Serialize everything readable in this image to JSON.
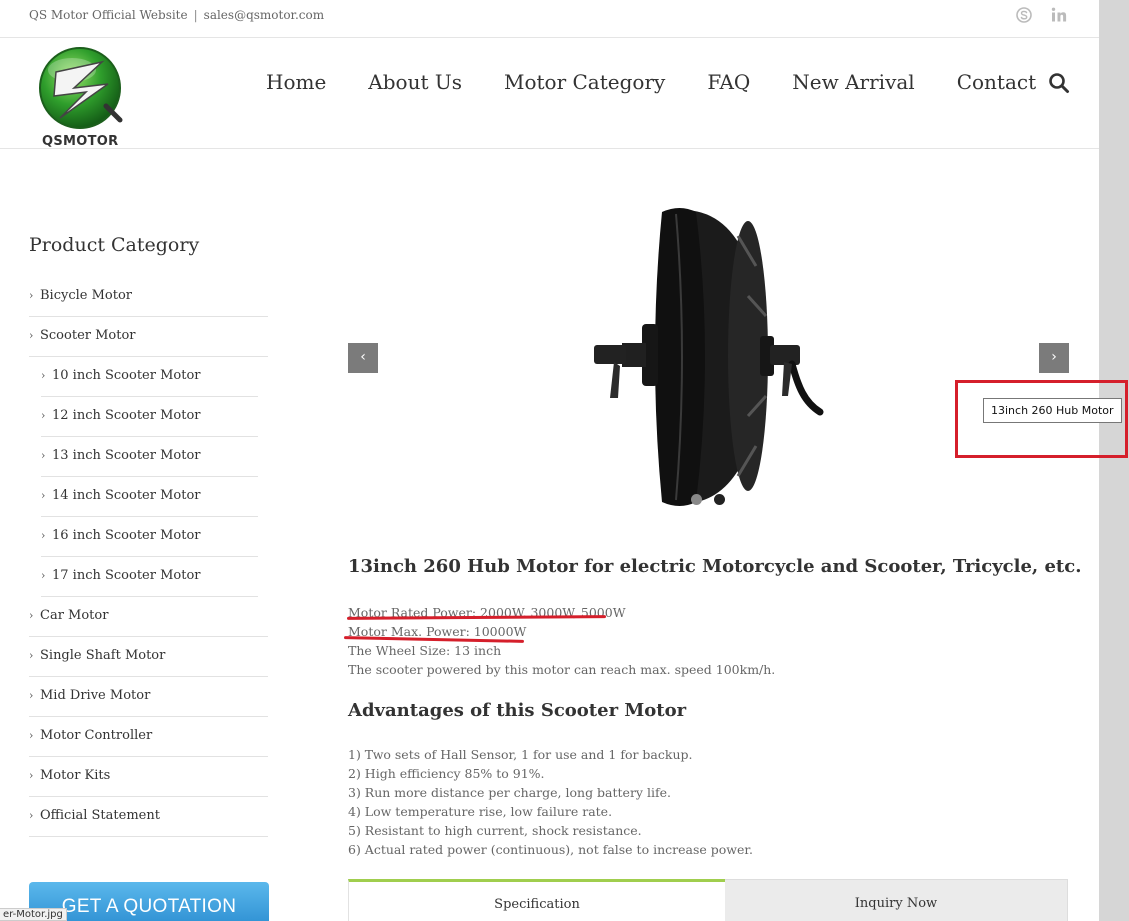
{
  "topbar": {
    "site_name": "QS Motor Official Website",
    "separator": "|",
    "email": "sales@qsmotor.com"
  },
  "header": {
    "logo_text": "QSMOTOR",
    "nav": [
      "Home",
      "About Us",
      "Motor Category",
      "FAQ",
      "New Arrival",
      "Contact"
    ]
  },
  "sidebar": {
    "title": "Product Category",
    "items": [
      {
        "label": "Bicycle Motor",
        "sub": false
      },
      {
        "label": "Scooter Motor",
        "sub": false
      },
      {
        "label": "10 inch Scooter Motor",
        "sub": true
      },
      {
        "label": "12 inch Scooter Motor",
        "sub": true
      },
      {
        "label": "13 inch Scooter Motor",
        "sub": true
      },
      {
        "label": "14 inch Scooter Motor",
        "sub": true
      },
      {
        "label": "16 inch Scooter Motor",
        "sub": true
      },
      {
        "label": "17 inch Scooter Motor",
        "sub": true
      },
      {
        "label": "Car Motor",
        "sub": false
      },
      {
        "label": "Single Shaft Motor",
        "sub": false
      },
      {
        "label": "Mid Drive Motor",
        "sub": false
      },
      {
        "label": "Motor Controller",
        "sub": false
      },
      {
        "label": "Motor Kits",
        "sub": false
      },
      {
        "label": "Official Statement",
        "sub": false
      }
    ],
    "quote_button": "GET A QUOTATION"
  },
  "slider": {
    "prev": "‹",
    "next": "›",
    "tooltip": "13inch 260 Hub Motor",
    "slides": 2,
    "active_slide": 2
  },
  "product": {
    "title": "13inch 260 Hub Motor for electric Motorcycle and Scooter, Tricycle, etc.",
    "specs": [
      "Motor Rated Power: 2000W, 3000W, 5000W",
      "Motor Max. Power: 10000W",
      "The Wheel Size: 13 inch",
      "The scooter powered by this motor can reach max. speed 100km/h."
    ],
    "advantages_title": "Advantages of this Scooter Motor",
    "advantages": [
      "1) Two sets of Hall Sensor, 1 for use and 1 for backup.",
      "2) High efficiency 85% to 91%.",
      "3) Run more distance per charge, long battery life.",
      "4) Low temperature rise, low failure rate.",
      "5) Resistant to high current, shock resistance.",
      "6) Actual rated power (continuous), not false to increase power."
    ]
  },
  "tabs": [
    "Specification",
    "Inquiry Now"
  ],
  "status_bar": {
    "url_fragment": "er-Motor.jpg"
  },
  "colors": {
    "highlight": "#d51f2b",
    "tab_accent": "#a0ce4e",
    "quote_button": "#3a9ddc"
  }
}
